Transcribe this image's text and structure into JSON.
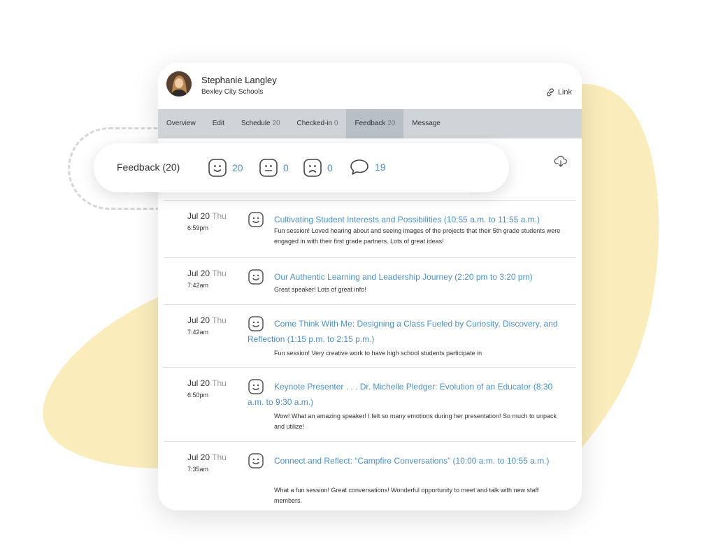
{
  "colors": {
    "accent": "#4a90c9",
    "blob": "#fbedbb",
    "tab_bar": "#cfd4d9",
    "tab_active": "#b9bfc6"
  },
  "profile": {
    "name": "Stephanie Langley",
    "organization": "Bexley City Schools",
    "link_label": "Link"
  },
  "tabs": [
    {
      "label": "Overview",
      "count": ""
    },
    {
      "label": "Edit",
      "count": ""
    },
    {
      "label": "Schedule",
      "count": "20"
    },
    {
      "label": "Checked-in",
      "count": "0"
    },
    {
      "label": "Feedback",
      "count": "20"
    },
    {
      "label": "Message",
      "count": ""
    }
  ],
  "active_tab": "Feedback",
  "summary": {
    "label": "Feedback (20)",
    "happy": "20",
    "neutral": "0",
    "sad": "0",
    "comments": "19"
  },
  "icons": {
    "happy": "happy-face-icon",
    "neutral": "neutral-face-icon",
    "sad": "sad-face-icon",
    "comment": "comment-bubble-icon",
    "download": "cloud-download-icon",
    "link": "link-icon"
  },
  "entries": [
    {
      "date": "Jul 20",
      "day": "Thu",
      "time": "6:59pm",
      "title": "Cultivating Student Interests and Possibilities (10:55 a.m. to 11:55 a.m.)",
      "comment": "Fun session! Loved hearing about and seeing images of the projects that their 5th grade students were engaged in with their first grade partners. Lots of great ideas!"
    },
    {
      "date": "Jul 20",
      "day": "Thu",
      "time": "7:42am",
      "title": "Our Authentic Learning and Leadership Journey (2:20 pm to 3:20 pm)",
      "comment": "Great speaker! Lots of great info!"
    },
    {
      "date": "Jul 20",
      "day": "Thu",
      "time": "7:42am",
      "title": "Come Think With Me: Designing a Class Fueled by Curiosity, Discovery, and Reflection (1:15 p.m. to 2:15 p.m.)",
      "comment": "Fun session! Very creative work to have high school students participate in"
    },
    {
      "date": "Jul 20",
      "day": "Thu",
      "time": "6:50pm",
      "title": "Keynote Presenter . . . Dr. Michelle Pledger: Evolution of an Educator (8:30 a.m. to 9:30 a.m.)",
      "comment": "Wow! What an amazing speaker! I felt so many emotions during her presentation! So much to unpack and utilize!"
    },
    {
      "date": "Jul 20",
      "day": "Thu",
      "time": "7:35am",
      "title": "Connect and Reflect: “Campfire Conversations” (10:00 a.m. to 10:55 a.m.)",
      "comment": "What a fun session! Great conversations! Wonderful opportunity to meet and talk with new staff members."
    }
  ]
}
